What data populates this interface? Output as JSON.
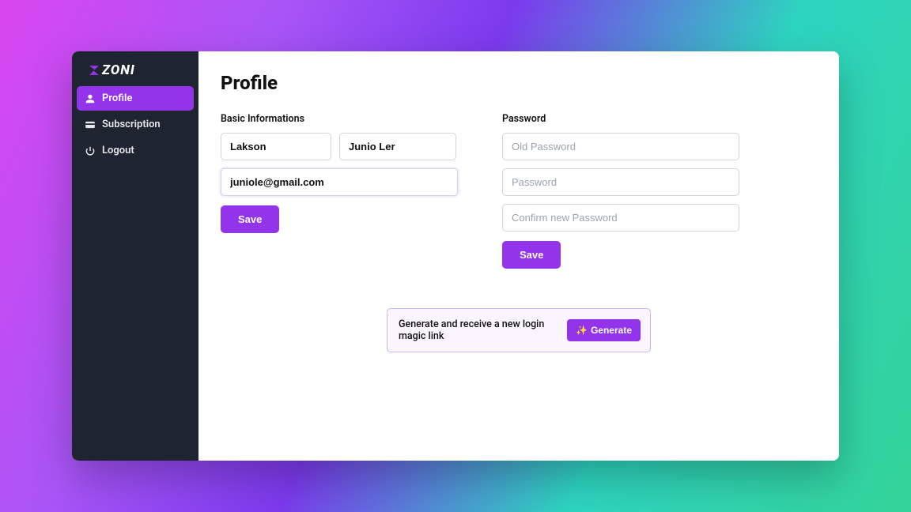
{
  "brand": "ZONI",
  "sidebar": {
    "items": [
      {
        "label": "Profile",
        "icon": "user-icon",
        "active": true
      },
      {
        "label": "Subscription",
        "icon": "card-icon",
        "active": false
      },
      {
        "label": "Logout",
        "icon": "power-icon",
        "active": false
      }
    ]
  },
  "page": {
    "title": "Profile",
    "basic": {
      "section_label": "Basic Informations",
      "first_name": "Lakson",
      "last_name": "Junio Ler",
      "email": "juniole@gmail.com",
      "save_label": "Save"
    },
    "password": {
      "section_label": "Password",
      "old_placeholder": "Old Password",
      "new_placeholder": "Password",
      "confirm_placeholder": "Confirm new Password",
      "save_label": "Save"
    },
    "magic": {
      "text": "Generate and receive a new login magic link",
      "button_label": "Generate"
    }
  },
  "colors": {
    "accent": "#9333ea",
    "sidebar_bg": "#1e2430"
  }
}
